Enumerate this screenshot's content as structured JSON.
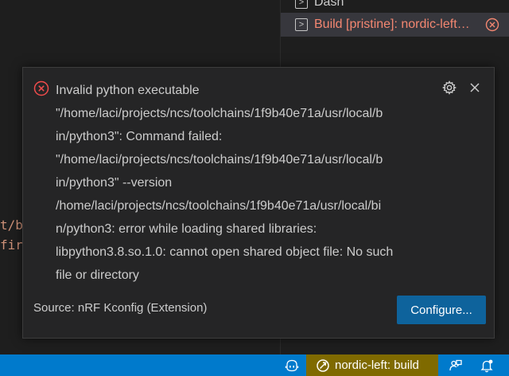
{
  "terminals": {
    "items": [
      {
        "label": "Dash",
        "state": "normal"
      },
      {
        "label": "Build [pristine]: nordic-left: build",
        "state": "error"
      }
    ]
  },
  "editor": {
    "fragments": [
      "t/b",
      "fir"
    ]
  },
  "notification": {
    "severity": "error",
    "message_lines": [
      "Invalid python executable",
      "\"/home/laci/projects/ncs/toolchains/1f9b40e71a/usr/local/b",
      "in/python3\": Command failed:",
      "\"/home/laci/projects/ncs/toolchains/1f9b40e71a/usr/local/b",
      "in/python3\" --version",
      "/home/laci/projects/ncs/toolchains/1f9b40e71a/usr/local/bi",
      "n/python3: error while loading shared libraries:",
      "libpython3.8.so.1.0: cannot open shared object file: No such",
      "file or directory"
    ],
    "source": "Source: nRF Kconfig (Extension)",
    "action_label": "Configure..."
  },
  "status_bar": {
    "build_label": "nordic-left: build"
  },
  "colors": {
    "accent": "#007acc",
    "error": "#f48771",
    "button": "#0e639c",
    "build_item_bg": "#7f6a00"
  }
}
